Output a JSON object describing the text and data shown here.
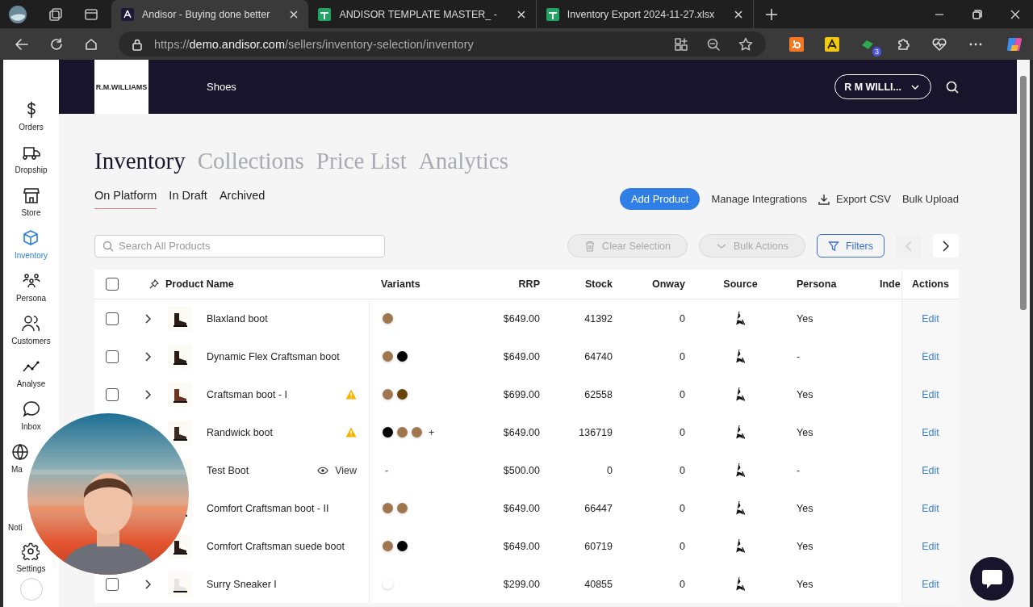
{
  "browser": {
    "tabs": [
      {
        "title": "Andisor - Buying done better",
        "kind": "app",
        "selected": true
      },
      {
        "title": "ANDISOR TEMPLATE MASTER_ -",
        "kind": "sheet",
        "selected": false
      },
      {
        "title": "Inventory Export 2024-11-27.xlsx",
        "kind": "sheet",
        "selected": false
      }
    ],
    "url_host": "demo.andisor.com",
    "url_scheme": "https://",
    "url_path": "/sellers/inventory-selection/inventory",
    "extension_badge": "3"
  },
  "header": {
    "brand": "R.M.WILLIAMS",
    "nav": "Shoes",
    "account": "R M WILLI..."
  },
  "sidebar": {
    "items": [
      {
        "label": "Orders",
        "selected": false
      },
      {
        "label": "Dropship",
        "selected": false
      },
      {
        "label": "Store",
        "selected": false
      },
      {
        "label": "Inventory",
        "selected": true
      },
      {
        "label": "Persona",
        "selected": false
      },
      {
        "label": "Customers",
        "selected": false
      },
      {
        "label": "Analyse",
        "selected": false
      },
      {
        "label": "Inbox",
        "selected": false
      },
      {
        "label": "Ma",
        "selected": false
      },
      {
        "label": "Noti",
        "selected": false
      },
      {
        "label": "Settings",
        "selected": false
      }
    ]
  },
  "sections": [
    {
      "label": "Inventory",
      "selected": true
    },
    {
      "label": "Collections",
      "selected": false
    },
    {
      "label": "Price List",
      "selected": false
    },
    {
      "label": "Analytics",
      "selected": false
    }
  ],
  "subtabs": [
    {
      "label": "On Platform",
      "selected": true
    },
    {
      "label": "In Draft",
      "selected": false
    },
    {
      "label": "Archived",
      "selected": false
    }
  ],
  "actions": [
    {
      "label": "Add Product",
      "kind": "primary"
    },
    {
      "label": "Manage Integrations",
      "kind": "link"
    },
    {
      "label": "Export CSV",
      "kind": "download"
    },
    {
      "label": "Bulk Upload",
      "kind": "link"
    }
  ],
  "search": {
    "placeholder": "Search All Products"
  },
  "toolbar": [
    {
      "label": "Clear Selection",
      "kind": "trash",
      "disabled": true
    },
    {
      "label": "Bulk Actions",
      "kind": "caret",
      "disabled": true
    },
    {
      "label": "Filters",
      "kind": "filter",
      "disabled": false
    }
  ],
  "pager": {
    "prev_disabled": true,
    "next_disabled": false
  },
  "table": {
    "all_checked": false,
    "columns": [
      "Product Name",
      "Variants",
      "RRP",
      "Stock",
      "Onway",
      "Source",
      "Persona",
      "Inde",
      "Actions"
    ],
    "rows": [
      {
        "name": "Blaxland boot",
        "checked": false,
        "warning": false,
        "view": "",
        "variants": [
          {
            "color": "#a0764e"
          }
        ],
        "more": "",
        "rrp": "$649.00",
        "stock": "41392",
        "onway": "0",
        "persona": "Yes",
        "action": "Edit"
      },
      {
        "name": "Dynamic Flex Craftsman boot",
        "checked": false,
        "warning": false,
        "view": "",
        "variants": [
          {
            "color": "#a0764e"
          },
          {
            "color": "#000000"
          }
        ],
        "more": "",
        "rrp": "$649.00",
        "stock": "64740",
        "onway": "0",
        "persona": "-",
        "action": "Edit"
      },
      {
        "name": "Craftsman boot - I",
        "checked": false,
        "warning": true,
        "view": "",
        "variants": [
          {
            "color": "#a0764e"
          },
          {
            "color": "#6b4508"
          }
        ],
        "more": "",
        "rrp": "$699.00",
        "stock": "62558",
        "onway": "0",
        "persona": "Yes",
        "action": "Edit"
      },
      {
        "name": "Randwick boot",
        "warning": true,
        "view": "",
        "variants": [
          {
            "color": "#000000"
          },
          {
            "color": "#a0764e"
          },
          {
            "color": "#a0764e"
          }
        ],
        "more": "+",
        "rrp": "$649.00",
        "stock": "136719",
        "onway": "0",
        "persona": "Yes",
        "action": "Edit"
      },
      {
        "name": "Test Boot",
        "warning": false,
        "view": "View",
        "variants": [],
        "more": "-",
        "rrp": "$500.00",
        "stock": "0",
        "onway": "0",
        "persona": "-",
        "action": "Edit"
      },
      {
        "name": "Comfort Craftsman boot - II",
        "warning": false,
        "view": "",
        "variants": [
          {
            "color": "#a0764e"
          },
          {
            "color": "#a0764e"
          }
        ],
        "more": "",
        "rrp": "$649.00",
        "stock": "66447",
        "onway": "0",
        "persona": "Yes",
        "action": "Edit"
      },
      {
        "name": "Comfort Craftsman suede boot",
        "warning": false,
        "view": "",
        "variants": [
          {
            "color": "#a0764e"
          },
          {
            "color": "#000000"
          }
        ],
        "more": "",
        "rrp": "$649.00",
        "stock": "60719",
        "onway": "0",
        "persona": "Yes",
        "action": "Edit"
      },
      {
        "name": "Surry Sneaker I",
        "checked": false,
        "warning": false,
        "view": "",
        "variants": [
          {
            "color": "#ffffff"
          }
        ],
        "more": "",
        "rrp": "$299.00",
        "stock": "40855",
        "onway": "0",
        "persona": "Yes",
        "action": "Edit"
      }
    ]
  }
}
